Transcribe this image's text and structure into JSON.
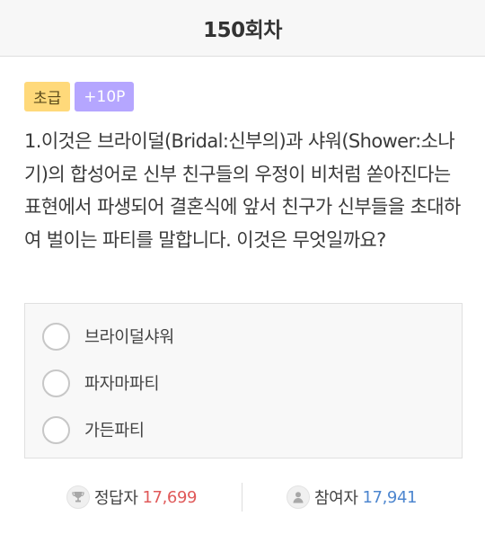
{
  "header": {
    "title": "150회차"
  },
  "badges": {
    "level": "초급",
    "points": "+10P"
  },
  "question": {
    "text": "1.이것은 브라이덜(Bridal:신부의)과 샤워(Shower:소나기)의 합성어로 신부 친구들의 우정이 비처럼 쏟아진다는 표현에서 파생되어 결혼식에 앞서 친구가 신부들을 초대하여 벌이는 파티를 말합니다. 이것은 무엇일까요?"
  },
  "options": [
    {
      "label": "브라이덜샤워"
    },
    {
      "label": "파자마파티"
    },
    {
      "label": "가든파티"
    }
  ],
  "stats": {
    "correct_label": "정답자",
    "correct_value": "17,699",
    "participants_label": "참여자",
    "participants_value": "17,941"
  },
  "colors": {
    "level_badge": "#ffd97a",
    "point_badge": "#b5a6ff",
    "correct_value": "#e05a5a",
    "participants_value": "#4d86cf"
  },
  "icons": {
    "correct": "trophy-icon",
    "participants": "person-icon"
  }
}
